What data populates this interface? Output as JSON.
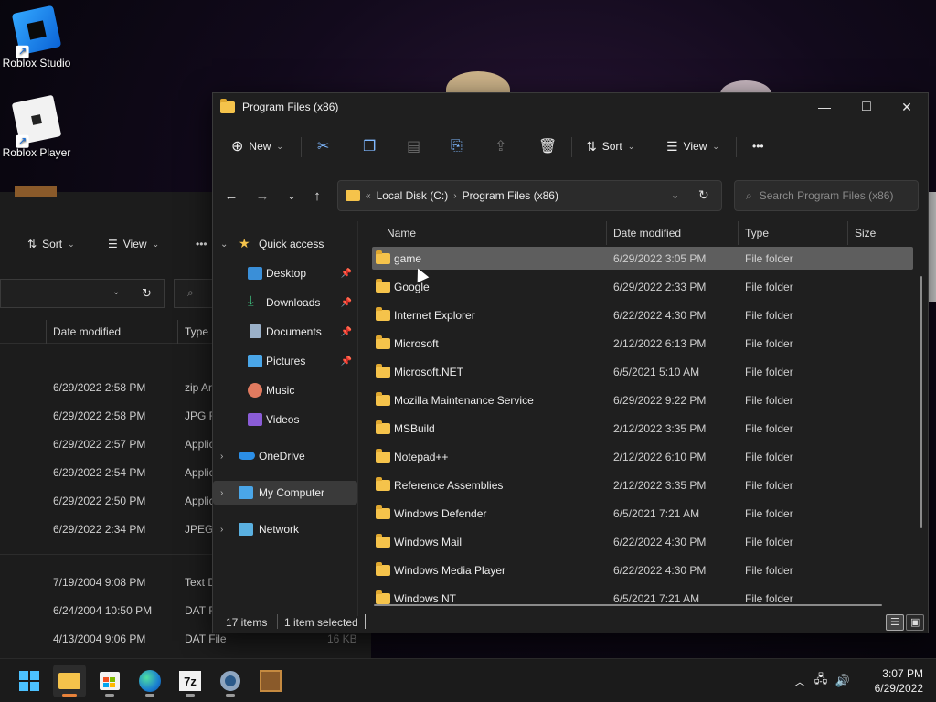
{
  "desktop": {
    "icons": [
      {
        "label": "Roblox Studio"
      },
      {
        "label": "Roblox Player"
      }
    ]
  },
  "bg_window": {
    "toolbar": {
      "sort": "Sort",
      "view": "View",
      "more": "•••"
    },
    "header": {
      "date": "Date modified",
      "type": "Type"
    },
    "rows": [
      {
        "date": "6/29/2022 2:58 PM",
        "type": "zip Ar"
      },
      {
        "date": "6/29/2022 2:58 PM",
        "type": "JPG Fi"
      },
      {
        "date": "6/29/2022 2:57 PM",
        "type": "Applic"
      },
      {
        "date": "6/29/2022 2:54 PM",
        "type": "Applic"
      },
      {
        "date": "6/29/2022 2:50 PM",
        "type": "Applic"
      },
      {
        "date": "6/29/2022 2:34 PM",
        "type": "JPEG"
      },
      {
        "date": "7/19/2004 9:08 PM",
        "type": "Text D"
      },
      {
        "date": "6/24/2004 10:50 PM",
        "type": "DAT F"
      },
      {
        "date": "4/13/2004 9:06 PM",
        "type": "DAT File",
        "size": "16 KB"
      }
    ]
  },
  "window": {
    "title": "Program Files (x86)",
    "caption": {
      "minimize": "—",
      "maximize": "□",
      "close": "✕"
    },
    "commands": {
      "new": "New",
      "sort": "Sort",
      "view": "View",
      "more": "•••"
    },
    "address": {
      "overflow": "«",
      "crumbs": [
        "Local Disk (C:)",
        "Program Files (x86)"
      ]
    },
    "search": {
      "placeholder": "Search Program Files (x86)"
    },
    "nav": {
      "quick_access": "Quick access",
      "items": [
        {
          "label": "Desktop",
          "icon": "desktop-icon",
          "pinned": true
        },
        {
          "label": "Downloads",
          "icon": "download-icon",
          "pinned": true
        },
        {
          "label": "Documents",
          "icon": "document-icon",
          "pinned": true
        },
        {
          "label": "Pictures",
          "icon": "pictures-icon",
          "pinned": true
        },
        {
          "label": "Music",
          "icon": "music-icon",
          "pinned": false
        },
        {
          "label": "Videos",
          "icon": "video-icon",
          "pinned": false
        }
      ],
      "onedrive": "OneDrive",
      "my_computer": "My Computer",
      "network": "Network"
    },
    "columns": {
      "name": "Name",
      "date": "Date modified",
      "type": "Type",
      "size": "Size"
    },
    "files": [
      {
        "name": "game",
        "date": "6/29/2022 3:05 PM",
        "type": "File folder",
        "selected": true
      },
      {
        "name": "Google",
        "date": "6/29/2022 2:33 PM",
        "type": "File folder"
      },
      {
        "name": "Internet Explorer",
        "date": "6/22/2022 4:30 PM",
        "type": "File folder"
      },
      {
        "name": "Microsoft",
        "date": "2/12/2022 6:13 PM",
        "type": "File folder"
      },
      {
        "name": "Microsoft.NET",
        "date": "6/5/2021 5:10 AM",
        "type": "File folder"
      },
      {
        "name": "Mozilla Maintenance Service",
        "date": "6/29/2022 9:22 PM",
        "type": "File folder"
      },
      {
        "name": "MSBuild",
        "date": "2/12/2022 3:35 PM",
        "type": "File folder"
      },
      {
        "name": "Notepad++",
        "date": "2/12/2022 6:10 PM",
        "type": "File folder"
      },
      {
        "name": "Reference Assemblies",
        "date": "2/12/2022 3:35 PM",
        "type": "File folder"
      },
      {
        "name": "Windows Defender",
        "date": "6/5/2021 7:21 AM",
        "type": "File folder"
      },
      {
        "name": "Windows Mail",
        "date": "6/22/2022 4:30 PM",
        "type": "File folder"
      },
      {
        "name": "Windows Media Player",
        "date": "6/22/2022 4:30 PM",
        "type": "File folder"
      },
      {
        "name": "Windows NT",
        "date": "6/5/2021 7:21 AM",
        "type": "File folder"
      }
    ],
    "status": {
      "count": "17 items",
      "selection": "1 item selected"
    }
  },
  "taskbar": {
    "apps": [
      {
        "name": "Start",
        "icon": "windows-icon"
      },
      {
        "name": "File Explorer",
        "icon": "folder-icon"
      },
      {
        "name": "Microsoft Store",
        "icon": "store-icon"
      },
      {
        "name": "Microsoft Edge",
        "icon": "edge-icon"
      },
      {
        "name": "7-Zip",
        "icon": "7zip-icon",
        "glyph": "7z"
      },
      {
        "name": "Settings",
        "icon": "gear-icon"
      },
      {
        "name": "BDSX",
        "icon": "bdsx-icon"
      }
    ],
    "clock": {
      "time": "3:07 PM",
      "date": "6/29/2022"
    }
  },
  "colors": {
    "folder": "#f5c34b",
    "accent": "#4cc2ff",
    "selected_row": "#5e5e5e"
  }
}
